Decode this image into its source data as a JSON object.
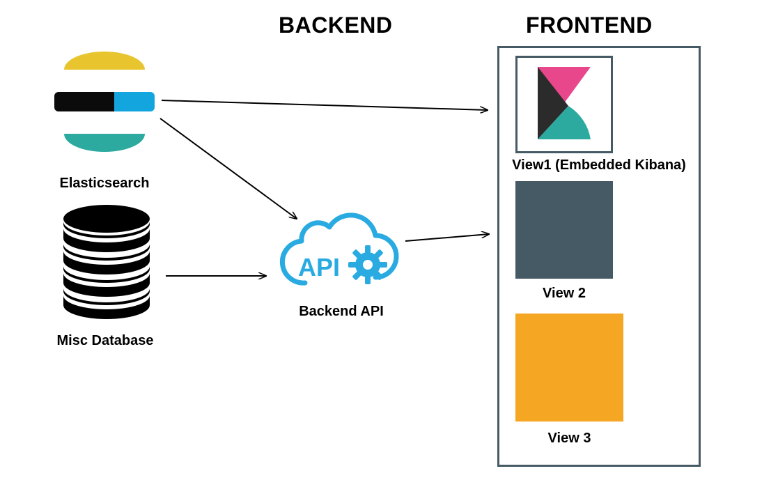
{
  "sections": {
    "backend": "BACKEND",
    "frontend": "FRONTEND"
  },
  "nodes": {
    "elasticsearch": {
      "label": "Elasticsearch"
    },
    "database": {
      "label": "Misc Database"
    },
    "api": {
      "label": "Backend API"
    },
    "view1": {
      "label": "View1 (Embedded Kibana)"
    },
    "view2": {
      "label": "View 2"
    },
    "view3": {
      "label": "View 3"
    }
  },
  "colors": {
    "frame": "#455a64",
    "orange": "#f5a623",
    "api_blue": "#29abe2",
    "es_yellow": "#e8c52e",
    "es_teal": "#2caaa0",
    "es_blue": "#12a5de",
    "es_black": "#0b0b0b",
    "kibana_pink": "#e8478b",
    "kibana_dark": "#2b2b2b",
    "kibana_teal": "#2caaa0"
  },
  "edges": [
    {
      "from": "elasticsearch",
      "to": "view1"
    },
    {
      "from": "elasticsearch",
      "to": "api"
    },
    {
      "from": "database",
      "to": "api"
    },
    {
      "from": "api",
      "to": "view2"
    }
  ]
}
